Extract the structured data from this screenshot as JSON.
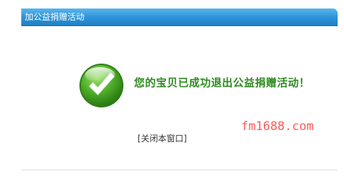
{
  "window": {
    "title": "加公益捐赠活动"
  },
  "dialog": {
    "message": "您的宝贝已成功退出公益捐赠活动！",
    "icon": "success-check-icon",
    "close_link": {
      "bracket_open": "[",
      "label": "关闭本窗口",
      "bracket_close": "]"
    }
  },
  "watermark": "fm1688.com",
  "colors": {
    "titlebar": "#2f95d8",
    "message": "#2e8b1f",
    "watermark": "#ff5a55"
  }
}
